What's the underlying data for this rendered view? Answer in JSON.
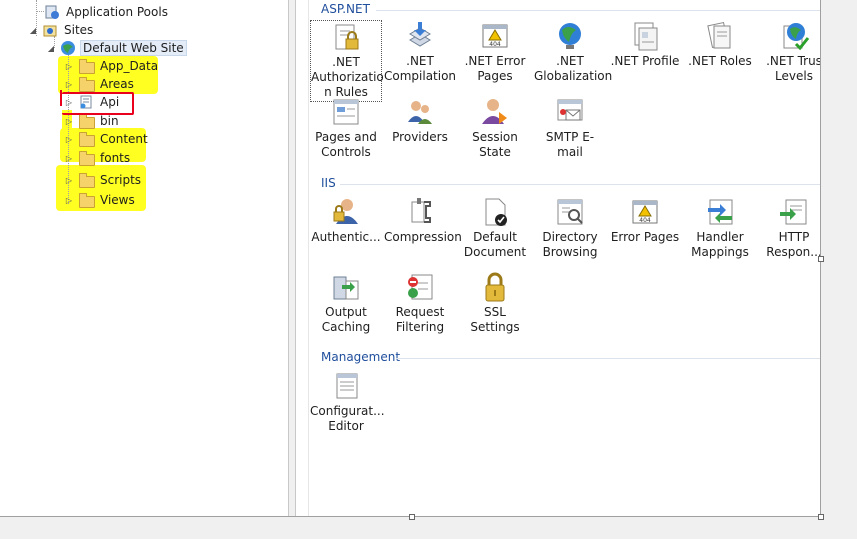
{
  "tree": {
    "app_pools": "Application Pools",
    "sites": "Sites",
    "default_site": "Default Web Site",
    "folders": [
      "App_Data",
      "Areas",
      "Api",
      "bin",
      "Content",
      "fonts",
      "Scripts",
      "Views"
    ]
  },
  "aspnet": {
    "title": "ASP.NET",
    "items": [
      ".NET Authorizatio n Rules",
      ".NET Compilation",
      ".NET Error Pages",
      ".NET Globalization",
      ".NET Profile",
      ".NET Roles",
      ".NET Trus Levels",
      "Pages and Controls",
      "Providers",
      "Session State",
      "SMTP E-mail"
    ]
  },
  "iis": {
    "title": "IIS",
    "items": [
      "Authentic...",
      "Compression",
      "Default Document",
      "Directory Browsing",
      "Error Pages",
      "Handler Mappings",
      "HTTP Respon...",
      "Output Caching",
      "Request Filtering",
      "SSL Settings"
    ]
  },
  "management": {
    "title": "Management",
    "items": [
      "Configurat... Editor"
    ]
  },
  "colors": {
    "highlight": "#ffff22",
    "annotation": "#e8001c",
    "section": "#1f4e9c"
  }
}
